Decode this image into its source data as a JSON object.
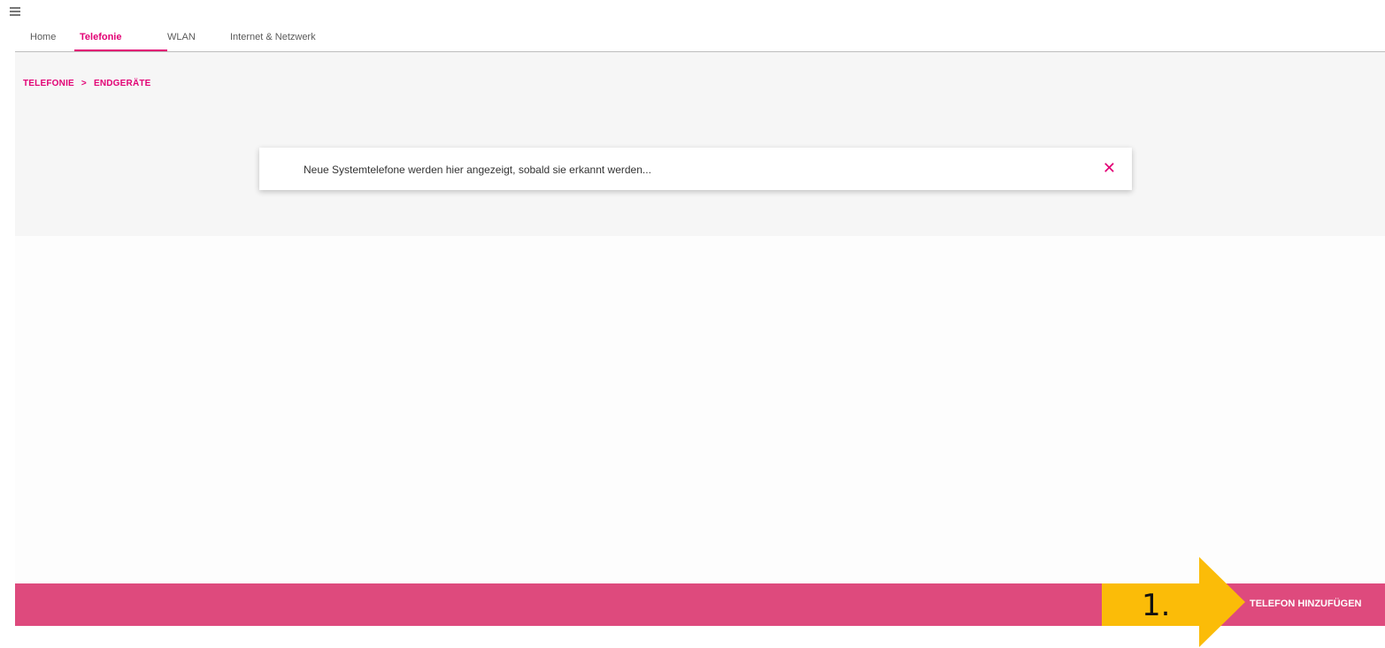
{
  "nav": {
    "menu_icon": "hamburger-icon",
    "tabs": [
      {
        "label": "Home",
        "active": false
      },
      {
        "label": "Telefonie",
        "active": true
      },
      {
        "label": "WLAN",
        "active": false
      },
      {
        "label": "Internet & Netzwerk",
        "active": false
      }
    ]
  },
  "breadcrumb": {
    "level1": "TELEFONIE",
    "separator": ">",
    "level2": "ENDGERÄTE"
  },
  "notice": {
    "text": "Neue Systemtelefone werden hier angezeigt, sobald sie erkannt werden...",
    "close_icon": "close-icon"
  },
  "footer": {
    "add_phone_label": "TELEFON HINZUFÜGEN"
  },
  "annotation": {
    "step_label": "1.",
    "arrow_icon": "arrow-right-icon"
  },
  "colors": {
    "accent": "#e20074",
    "bar": "#de4a7d",
    "annotation": "#fbbc08"
  }
}
